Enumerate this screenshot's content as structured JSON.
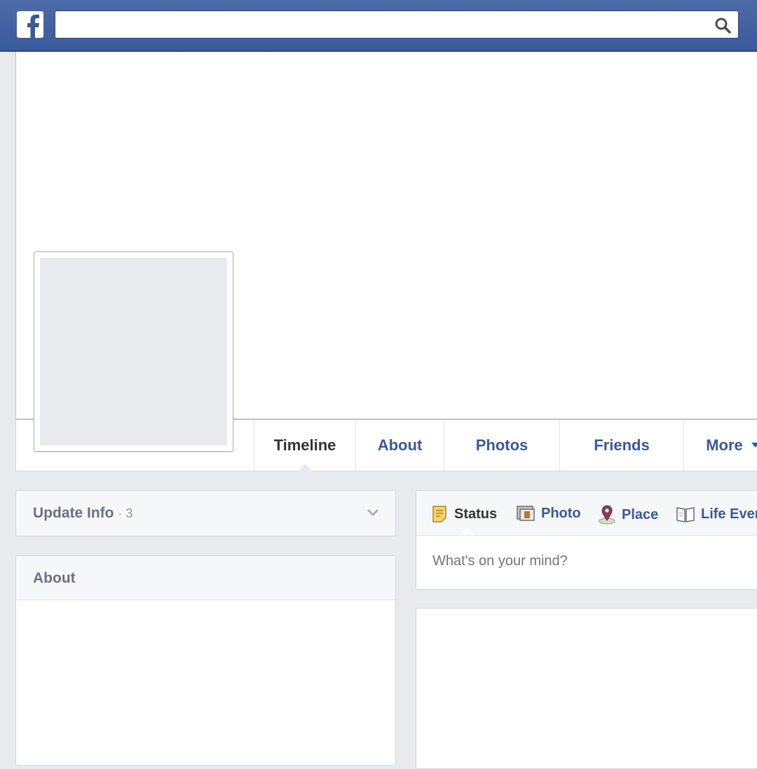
{
  "search": {
    "value": "",
    "placeholder": ""
  },
  "icons": {
    "logo": "facebook-logo",
    "search": "search-icon",
    "more_caret": "caret-down-icon",
    "chevron": "chevron-down-icon",
    "status": "status-note-icon",
    "photo": "photo-icon",
    "place": "place-pin-icon",
    "life_event": "life-event-book-icon"
  },
  "colors": {
    "brand": "#3b5998",
    "topbar": "#4d6aa8"
  },
  "nav": {
    "tabs": [
      {
        "label": "Timeline",
        "active": true
      },
      {
        "label": "About"
      },
      {
        "label": "Photos"
      },
      {
        "label": "Friends"
      },
      {
        "label": "More"
      }
    ]
  },
  "update_info": {
    "label": "Update Info",
    "count": "· 3"
  },
  "about": {
    "title": "About"
  },
  "composer": {
    "tabs": [
      {
        "label": "Status",
        "active": true
      },
      {
        "label": "Photo"
      },
      {
        "label": "Place"
      },
      {
        "label": "Life Even"
      }
    ],
    "placeholder": "What's on your mind?"
  }
}
